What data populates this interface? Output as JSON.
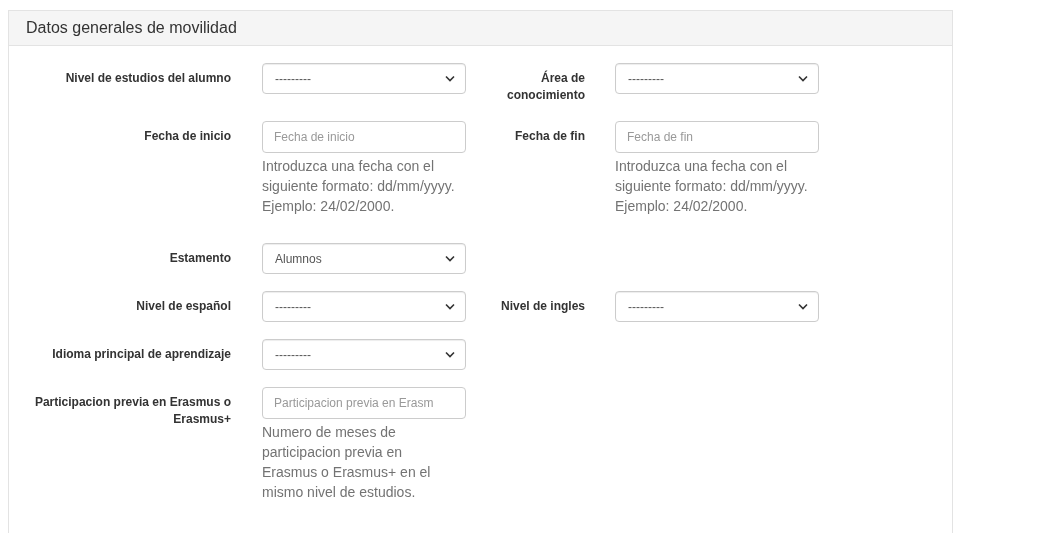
{
  "panel": {
    "title": "Datos generales de movilidad"
  },
  "rows": [
    {
      "fields": [
        {
          "label": "Nivel de estudios del alumno",
          "kind": "select",
          "value": "---------"
        },
        {
          "label": "Área de conocimiento",
          "kind": "select",
          "value": "---------"
        }
      ]
    },
    {
      "fields": [
        {
          "label": "Fecha de inicio",
          "kind": "text",
          "placeholder": "Fecha de inicio",
          "help": "Introduzca una fecha con el siguiente formato: dd/mm/yyyy. Ejemplo: 24/02/2000."
        },
        {
          "label": "Fecha de fin",
          "kind": "text",
          "placeholder": "Fecha de fin",
          "help": "Introduzca una fecha con el siguiente formato: dd/mm/yyyy. Ejemplo: 24/02/2000."
        }
      ]
    },
    {
      "fields": [
        {
          "label": "Estamento",
          "kind": "select",
          "value": "Alumnos"
        }
      ]
    },
    {
      "fields": [
        {
          "label": "Nivel de español",
          "kind": "select",
          "value": "---------"
        },
        {
          "label": "Nivel de ingles",
          "kind": "select",
          "value": "---------"
        }
      ]
    },
    {
      "fields": [
        {
          "label": "Idioma principal de aprendizaje",
          "kind": "select",
          "value": "---------"
        }
      ]
    },
    {
      "fields": [
        {
          "label": "Participacion previa en Erasmus o Erasmus+",
          "kind": "text",
          "placeholder": "Participacion previa en Erasm",
          "help": "Numero de meses de participacion previa en Erasmus o Erasmus+ en el mismo nivel de estudios."
        }
      ]
    }
  ]
}
